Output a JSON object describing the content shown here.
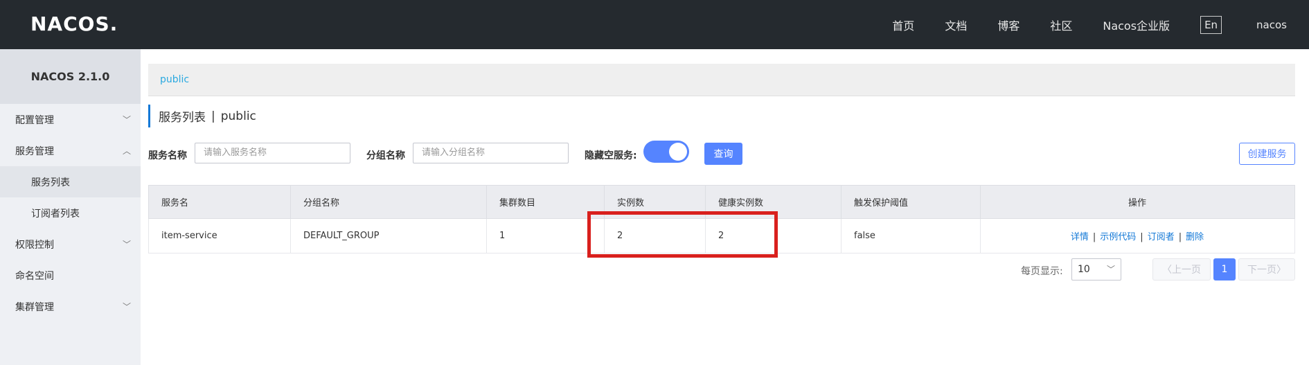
{
  "topbar": {
    "logo": "NACOS.",
    "nav": [
      "首页",
      "文档",
      "博客",
      "社区",
      "Nacos企业版"
    ],
    "lang": "En",
    "user": "nacos"
  },
  "sidebar": {
    "version": "NACOS 2.1.0",
    "items": [
      {
        "label": "配置管理",
        "chevron": "﹀"
      },
      {
        "label": "服务管理",
        "chevron": "︿"
      },
      {
        "label": "服务列表"
      },
      {
        "label": "订阅者列表"
      },
      {
        "label": "权限控制",
        "chevron": "﹀"
      },
      {
        "label": "命名空间"
      },
      {
        "label": "集群管理",
        "chevron": "﹀"
      }
    ]
  },
  "breadcrumb": "public",
  "page_title": {
    "main": "服务列表",
    "sep": "|",
    "namespace": "public"
  },
  "filters": {
    "service_label": "服务名称",
    "service_placeholder": "请输入服务名称",
    "group_label": "分组名称",
    "group_placeholder": "请输入分组名称",
    "hide_empty_label": "隐藏空服务:",
    "search_button": "查询",
    "create_button": "创建服务"
  },
  "table": {
    "columns": [
      "服务名",
      "分组名称",
      "集群数目",
      "实例数",
      "健康实例数",
      "触发保护阈值",
      "操作"
    ],
    "rows": [
      {
        "service": "item-service",
        "group": "DEFAULT_GROUP",
        "clusters": "1",
        "instances": "2",
        "healthy": "2",
        "threshold": "false",
        "ops": [
          "详情",
          "示例代码",
          "订阅者",
          "删除"
        ]
      }
    ]
  },
  "pagination": {
    "page_size_label": "每页显示:",
    "page_size": "10",
    "prev": "上一页",
    "current": "1",
    "next": "下一页"
  }
}
